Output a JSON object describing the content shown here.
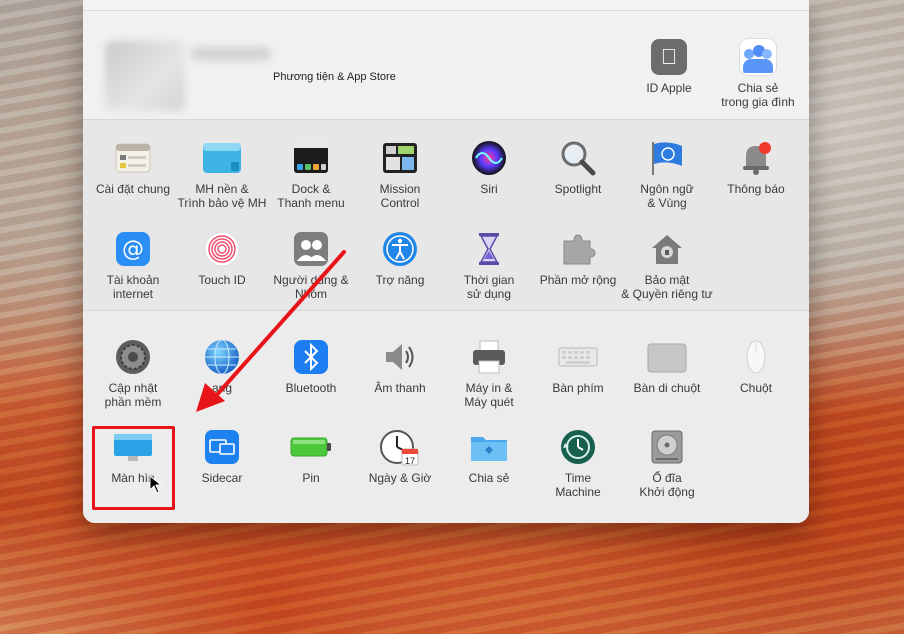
{
  "account": {
    "subtitle": "Phương tiện & App Store",
    "apple_id_label": "ID Apple",
    "family_label_l1": "Chia sẻ",
    "family_label_l2": "trong gia đình"
  },
  "row1": [
    {
      "l1": "Cài đặt chung",
      "l2": ""
    },
    {
      "l1": "MH nền &",
      "l2": "Trình bảo vệ MH"
    },
    {
      "l1": "Dock &",
      "l2": "Thanh menu"
    },
    {
      "l1": "Mission",
      "l2": "Control"
    },
    {
      "l1": "Siri",
      "l2": ""
    },
    {
      "l1": "Spotlight",
      "l2": ""
    },
    {
      "l1": "Ngôn ngữ",
      "l2": "& Vùng"
    },
    {
      "l1": "Thông báo",
      "l2": ""
    }
  ],
  "row2": [
    {
      "l1": "Tài khoản",
      "l2": "internet"
    },
    {
      "l1": "Touch ID",
      "l2": ""
    },
    {
      "l1": "Người dùng &",
      "l2": "Nhóm"
    },
    {
      "l1": "Trợ năng",
      "l2": ""
    },
    {
      "l1": "Thời gian",
      "l2": "sử dụng"
    },
    {
      "l1": "Phần mở rộng",
      "l2": ""
    },
    {
      "l1": "Bảo mật",
      "l2": "& Quyền riêng tư"
    }
  ],
  "row3": [
    {
      "l1": "Cập nhật",
      "l2": "phần mềm"
    },
    {
      "l1": "ạng",
      "l2": ""
    },
    {
      "l1": "Bluetooth",
      "l2": ""
    },
    {
      "l1": "Âm thanh",
      "l2": ""
    },
    {
      "l1": "Máy in &",
      "l2": "Máy quét"
    },
    {
      "l1": "Bàn phím",
      "l2": ""
    },
    {
      "l1": "Bàn di chuột",
      "l2": ""
    },
    {
      "l1": "Chuột",
      "l2": ""
    }
  ],
  "row4": [
    {
      "l1": "Màn hìn",
      "l2": ""
    },
    {
      "l1": "Sidecar",
      "l2": ""
    },
    {
      "l1": "Pin",
      "l2": ""
    },
    {
      "l1": "Ngày & Giờ",
      "l2": ""
    },
    {
      "l1": "Chia sẻ",
      "l2": ""
    },
    {
      "l1": "Time",
      "l2": "Machine"
    },
    {
      "l1": "Ổ đĩa",
      "l2": "Khởi động"
    }
  ],
  "calendar_day": "17",
  "calendar_month": "JUL",
  "colors": {
    "highlight": "#e8141a",
    "arrow": "#e8141a"
  }
}
